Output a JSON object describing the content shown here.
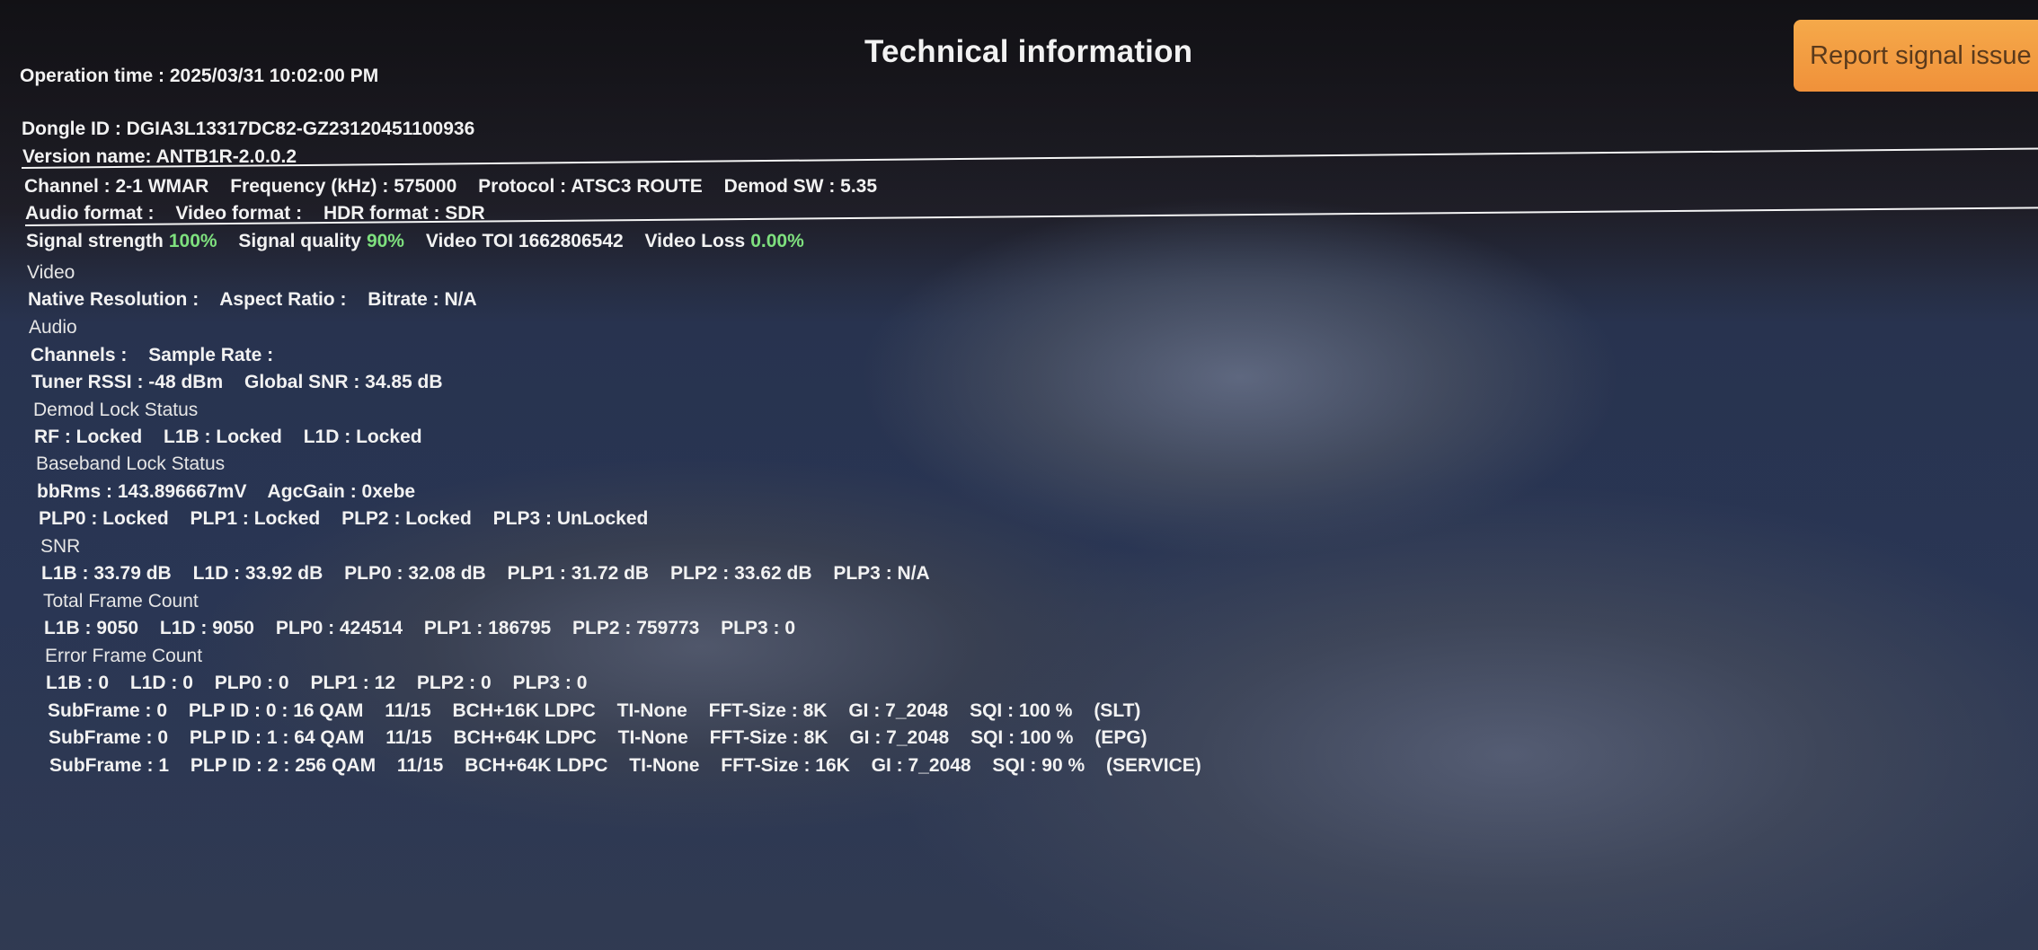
{
  "title": "Technical information",
  "report_button": "Report signal issue",
  "operation_time": "Operation time : 2025/03/31 10:02:00 PM",
  "dongle_id": "Dongle ID : DGIA3L13317DC82-GZ23120451100936",
  "version_name": "Version name: ANTB1R-2.0.0.2",
  "channel_line": {
    "channel": "Channel : 2-1 WMAR",
    "frequency": "Frequency (kHz) : 575000",
    "protocol": "Protocol : ATSC3 ROUTE",
    "demod_sw": "Demod SW : 5.35"
  },
  "format_line": {
    "audio": "Audio format :",
    "video": "Video format :",
    "hdr": "HDR format : SDR"
  },
  "signal_line": {
    "strength_label": "Signal strength",
    "strength_value": "100%",
    "quality_label": "Signal quality",
    "quality_value": "90%",
    "toi": "Video TOI 1662806542",
    "loss_label": "Video Loss",
    "loss_value": "0.00%"
  },
  "video_section": "Video",
  "video_line": {
    "resolution": "Native Resolution :",
    "aspect": "Aspect Ratio :",
    "bitrate": "Bitrate : N/A"
  },
  "audio_section": "Audio",
  "audio_line": {
    "channels": "Channels :",
    "sample_rate": "Sample Rate :"
  },
  "tuner_line": {
    "rssi": "Tuner RSSI : -48 dBm",
    "snr": "Global SNR : 34.85 dB"
  },
  "demod_section": "Demod Lock Status",
  "demod_line": {
    "rf": "RF : Locked",
    "l1b": "L1B : Locked",
    "l1d": "L1D : Locked"
  },
  "baseband_section": "Baseband Lock Status",
  "baseband_line": {
    "bbrms": "bbRms : 143.896667mV",
    "agc": "AgcGain : 0xebe"
  },
  "plp_lock_line": {
    "plp0": "PLP0 : Locked",
    "plp1": "PLP1 : Locked",
    "plp2": "PLP2 : Locked",
    "plp3": "PLP3 : UnLocked"
  },
  "snr_section": "SNR",
  "snr_line": {
    "l1b": "L1B : 33.79 dB",
    "l1d": "L1D : 33.92 dB",
    "plp0": "PLP0 : 32.08 dB",
    "plp1": "PLP1 : 31.72 dB",
    "plp2": "PLP2 : 33.62 dB",
    "plp3": "PLP3 : N/A"
  },
  "total_frame_section": "Total Frame Count",
  "total_frame_line": {
    "l1b": "L1B : 9050",
    "l1d": "L1D : 9050",
    "plp0": "PLP0 : 424514",
    "plp1": "PLP1 : 186795",
    "plp2": "PLP2 : 759773",
    "plp3": "PLP3 : 0"
  },
  "error_frame_section": "Error Frame Count",
  "error_frame_line": {
    "l1b": "L1B : 0",
    "l1d": "L1D : 0",
    "plp0": "PLP0 : 0",
    "plp1": "PLP1 : 12",
    "plp2": "PLP2 : 0",
    "plp3": "PLP3 : 0"
  },
  "subframes": [
    {
      "subframe": "SubFrame : 0",
      "plp": "PLP ID : 0 : 16 QAM",
      "rate": "11/15",
      "code": "BCH+16K LDPC",
      "ti": "TI-None",
      "fft": "FFT-Size : 8K",
      "gi": "GI : 7_2048",
      "sqi": "SQI : 100 %",
      "type": "(SLT)"
    },
    {
      "subframe": "SubFrame : 0",
      "plp": "PLP ID : 1 : 64 QAM",
      "rate": "11/15",
      "code": "BCH+64K LDPC",
      "ti": "TI-None",
      "fft": "FFT-Size : 8K",
      "gi": "GI : 7_2048",
      "sqi": "SQI : 100 %",
      "type": "(EPG)"
    },
    {
      "subframe": "SubFrame : 1",
      "plp": "PLP ID : 2 : 256 QAM",
      "rate": "11/15",
      "code": "BCH+64K LDPC",
      "ti": "TI-None",
      "fft": "FFT-Size : 16K",
      "gi": "GI : 7_2048",
      "sqi": "SQI : 90 %",
      "type": "(SERVICE)"
    }
  ]
}
